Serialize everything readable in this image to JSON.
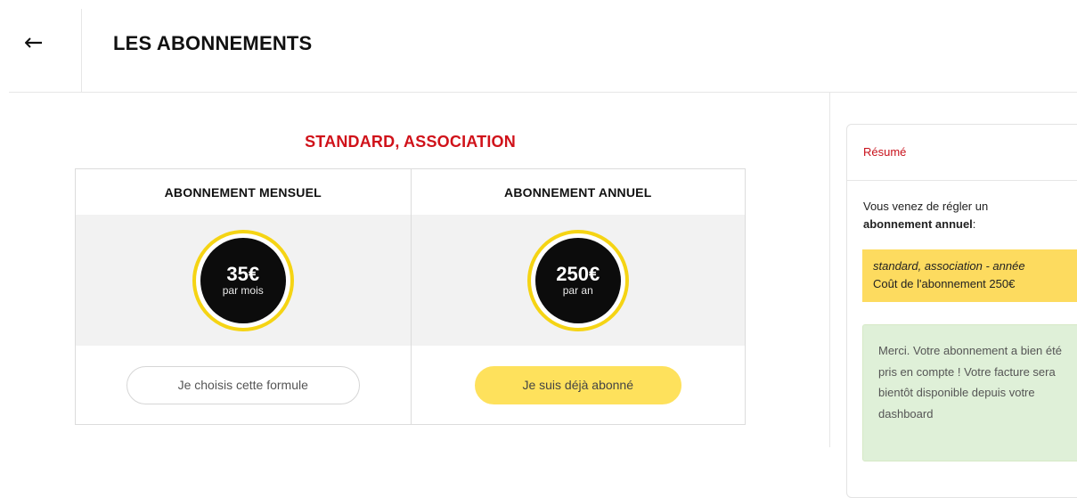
{
  "header": {
    "back_icon": "arrow-left-icon",
    "title": "LES ABONNEMENTS"
  },
  "plan_group": {
    "title": "STANDARD, ASSOCIATION",
    "plans": [
      {
        "name": "ABONNEMENT MENSUEL",
        "price": "35€",
        "period": "par mois",
        "button": "Je choisis cette formule"
      },
      {
        "name": "ABONNEMENT ANNUEL",
        "price": "250€",
        "period": "par an",
        "button": "Je suis déjà abonné"
      }
    ]
  },
  "summary": {
    "title": "Résumé",
    "intro": "Vous venez de régler un",
    "intro_bold": "abonnement annuel",
    "intro_suffix": ":",
    "highlight_line1": "standard, association - année",
    "highlight_line2": "Coût de l'abonnement 250€",
    "alert": "Merci. Votre abonnement a bien été pris en compte ! Votre facture sera bientôt disponible depuis votre dashboard"
  },
  "colors": {
    "accent_red": "#d0121a",
    "badge_yellow": "#f5d414",
    "button_yellow": "#fee15c",
    "highlight_yellow": "#fddb5f",
    "alert_green": "#dff0d8"
  }
}
